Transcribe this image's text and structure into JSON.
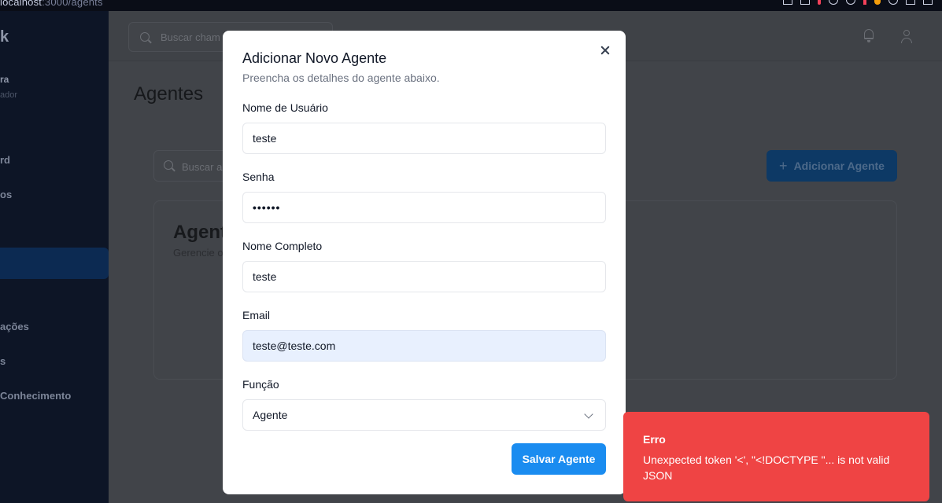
{
  "browser": {
    "url_host": "localhost",
    "url_path": ":3000/agents"
  },
  "sidebar": {
    "logo": "k",
    "user_name": "ra",
    "user_role": "ador",
    "items": [
      {
        "label": "rd"
      },
      {
        "label": "os"
      },
      {
        "label": ""
      },
      {
        "label": "ações"
      },
      {
        "label": "s"
      },
      {
        "label": "Conhecimento"
      }
    ]
  },
  "topbar": {
    "search_placeholder": "Buscar cham"
  },
  "page": {
    "title": "Agentes",
    "filter_placeholder": "Buscar a",
    "add_button": "Adicionar Agente",
    "card_title": "Agent",
    "card_subtitle": "Gerencie o"
  },
  "modal": {
    "title": "Adicionar Novo Agente",
    "description": "Preencha os detalhes do agente abaixo.",
    "fields": {
      "username": {
        "label": "Nome de Usuário",
        "value": "teste"
      },
      "password": {
        "label": "Senha",
        "value": "••••••"
      },
      "fullname": {
        "label": "Nome Completo",
        "value": "teste"
      },
      "email": {
        "label": "Email",
        "value": "teste@teste.com"
      },
      "role": {
        "label": "Função",
        "value": "Agente"
      }
    },
    "save_button": "Salvar Agente"
  },
  "toast": {
    "title": "Erro",
    "message": "Unexpected token '<', \"<!DOCTYPE \"... is not valid JSON",
    "color": "#ef4444"
  }
}
